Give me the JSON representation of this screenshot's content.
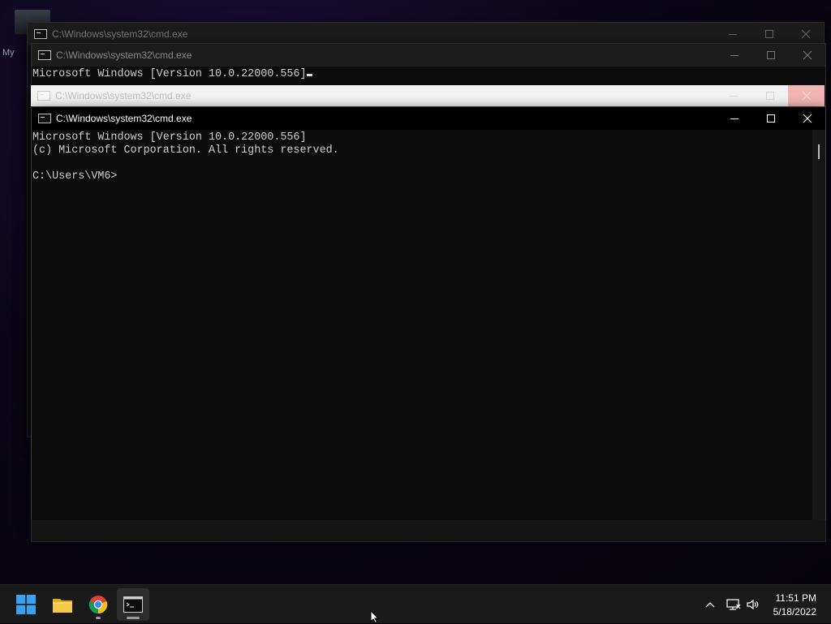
{
  "desktop": {
    "icon_label_fragment": "My"
  },
  "windows": [
    {
      "title": "C:\\Windows\\system32\\cmd.exe",
      "state": "background",
      "console_lines": []
    },
    {
      "title": "C:\\Windows\\system32\\cmd.exe",
      "state": "background",
      "console_lines": [
        "Microsoft Windows [Version 10.0.22000.556]"
      ]
    },
    {
      "title": "C:\\Windows\\system32\\cmd.exe",
      "state": "opening-transition",
      "console_lines": []
    },
    {
      "title": "C:\\Windows\\system32\\cmd.exe",
      "state": "active",
      "console_lines": [
        "Microsoft Windows [Version 10.0.22000.556]",
        "(c) Microsoft Corporation. All rights reserved.",
        "",
        "C:\\Users\\VM6>"
      ]
    }
  ],
  "window_controls": {
    "minimize": "minimize-icon",
    "maximize": "maximize-icon",
    "close": "close-icon"
  },
  "taskbar": {
    "apps": [
      {
        "name": "Start",
        "icon": "windows-logo-icon",
        "running": false
      },
      {
        "name": "File Explorer",
        "icon": "folder-icon",
        "running": false
      },
      {
        "name": "Google Chrome",
        "icon": "chrome-icon",
        "running": true
      },
      {
        "name": "Command Prompt",
        "icon": "cmd-icon",
        "running": true,
        "active": true
      }
    ],
    "tray": {
      "icons": [
        "chevron-up-icon",
        "network-icon",
        "volume-icon"
      ],
      "time": "11:51 PM",
      "date": "5/18/2022"
    }
  },
  "colors": {
    "console_text": "#cccccc",
    "console_bg": "#0c0c0c",
    "taskbar_bg": "#1a1a1a",
    "windows_blue": "#3aa0f0"
  }
}
